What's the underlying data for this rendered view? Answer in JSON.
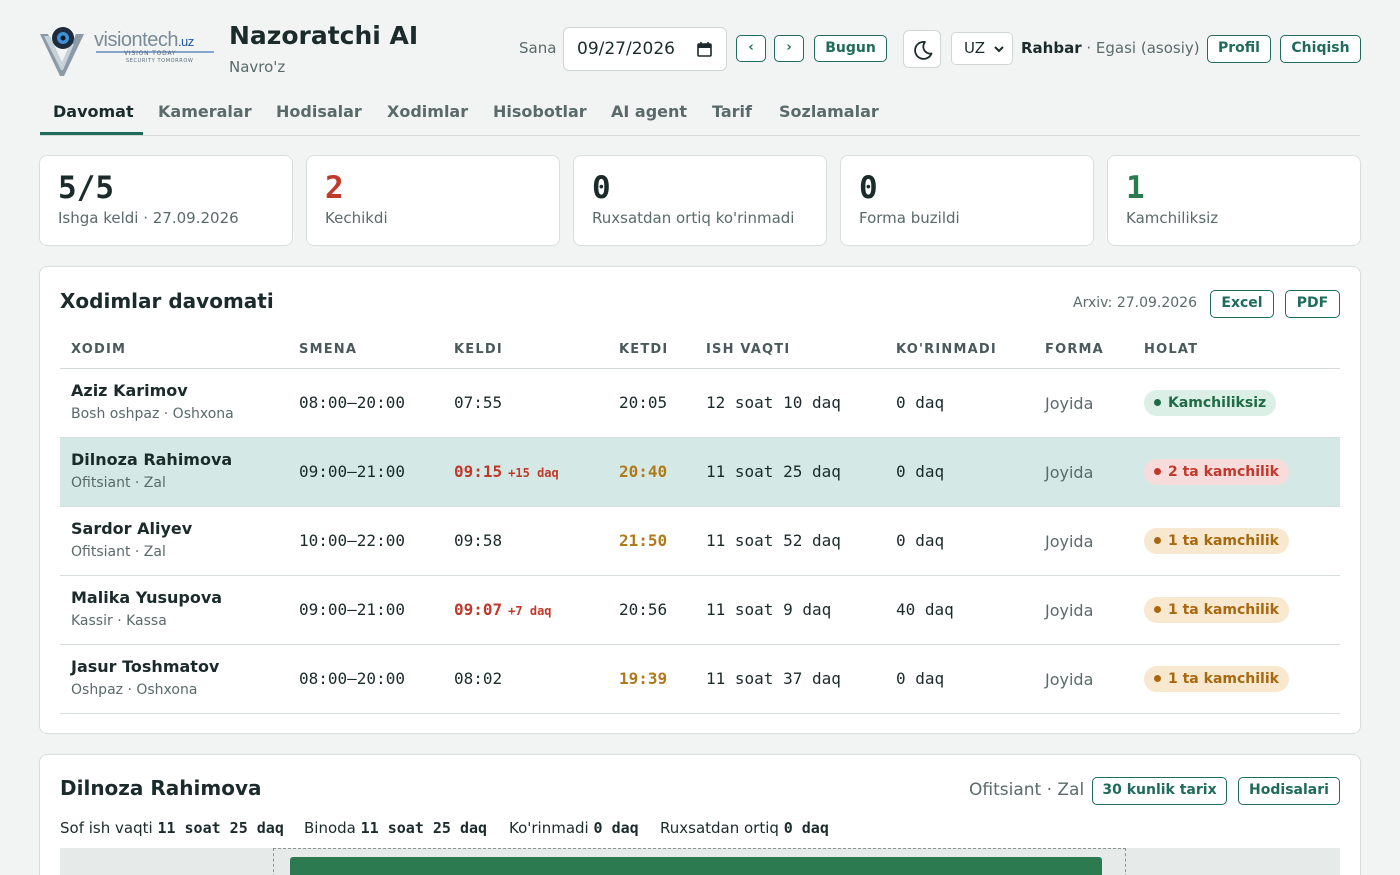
{
  "header": {
    "logo": {
      "brand": "visiontech",
      "tld": ".uz",
      "tagline1": "VISION TODAY",
      "tagline2": "SECURITY TOMORROW"
    },
    "title": "Nazoratchi AI",
    "subtitle": "Navro'z",
    "date_label": "Sana",
    "date_value": "09/27/2026",
    "prev_label": "‹",
    "next_label": "›",
    "today_label": "Bugun",
    "lang_value": "UZ",
    "user_role": "Rahbar",
    "user_detail": " · Egasi (asosiy)",
    "profile_label": "Profil",
    "logout_label": "Chiqish"
  },
  "tabs": [
    "Davomat",
    "Kameralar",
    "Hodisalar",
    "Xodimlar",
    "Hisobotlar",
    "AI agent",
    "Tarif",
    "Sozlamalar"
  ],
  "stats": [
    {
      "value": "5/5",
      "label": "Ishga keldi · 27.09.2026",
      "color": "#1b2a2a"
    },
    {
      "value": "2",
      "label": "Kechikdi",
      "color": "#c0392b"
    },
    {
      "value": "0",
      "label": "Ruxsatdan ortiq ko'rinmadi",
      "color": "#1b2a2a"
    },
    {
      "value": "0",
      "label": "Forma buzildi",
      "color": "#1b2a2a"
    },
    {
      "value": "1",
      "label": "Kamchiliksiz",
      "color": "#2b7a50"
    }
  ],
  "attendance": {
    "title": "Xodimlar davomati",
    "archive": "Arxiv: 27.09.2026",
    "excel_label": "Excel",
    "pdf_label": "PDF",
    "columns": [
      "XODIM",
      "SMENA",
      "KELDI",
      "KETDI",
      "ISH VAQTI",
      "KO'RINMADI",
      "FORMA",
      "HOLAT"
    ],
    "rows": [
      {
        "name": "Aziz Karimov",
        "role": "Bosh oshpaz · Oshxona",
        "shift": "08:00–20:00",
        "arrived": "07:55",
        "arrived_extra": "",
        "left": "20:05",
        "work": "12 soat 10 daq",
        "unseen": "0 daq",
        "uniform": "Joyida",
        "status": "Kamchiliksiz"
      },
      {
        "name": "Dilnoza Rahimova",
        "role": "Ofitsiant · Zal",
        "shift": "09:00–21:00",
        "arrived": "09:15",
        "arrived_extra": "+15 daq",
        "left": "20:40",
        "work": "11 soat 25 daq",
        "unseen": "0 daq",
        "uniform": "Joyida",
        "status": "2 ta kamchilik"
      },
      {
        "name": "Sardor Aliyev",
        "role": "Ofitsiant · Zal",
        "shift": "10:00–22:00",
        "arrived": "09:58",
        "arrived_extra": "",
        "left": "21:50",
        "work": "11 soat 52 daq",
        "unseen": "0 daq",
        "uniform": "Joyida",
        "status": "1 ta kamchilik"
      },
      {
        "name": "Malika Yusupova",
        "role": "Kassir · Kassa",
        "shift": "09:00–21:00",
        "arrived": "09:07",
        "arrived_extra": "+7 daq",
        "left": "20:56",
        "work": "11 soat 9 daq",
        "unseen": "40 daq",
        "uniform": "Joyida",
        "status": "1 ta kamchilik"
      },
      {
        "name": "Jasur Toshmatov",
        "role": "Oshpaz · Oshxona",
        "shift": "08:00–20:00",
        "arrived": "08:02",
        "arrived_extra": "",
        "left": "19:39",
        "work": "11 soat 37 daq",
        "unseen": "0 daq",
        "uniform": "Joyida",
        "status": "1 ta kamchilik"
      }
    ]
  },
  "detail": {
    "name": "Dilnoza Rahimova",
    "role": "Ofitsiant · Zal",
    "history_label": "30 kunlik tarix",
    "events_label": "Hodisalari",
    "summary": [
      {
        "label": "Sof ish vaqti",
        "value": "11 soat 25 daq"
      },
      {
        "label": "Binoda",
        "value": "11 soat 25 daq"
      },
      {
        "label": "Ko'rinmadi",
        "value": "0 daq"
      },
      {
        "label": "Ruxsatdan ortiq",
        "value": "0 daq"
      }
    ]
  },
  "colors": {
    "accent": "#1f6b5c",
    "late": "#c0392b",
    "early": "#b07a1a",
    "ok": "#2b7a50",
    "selected_row": "#d4e9e5"
  }
}
